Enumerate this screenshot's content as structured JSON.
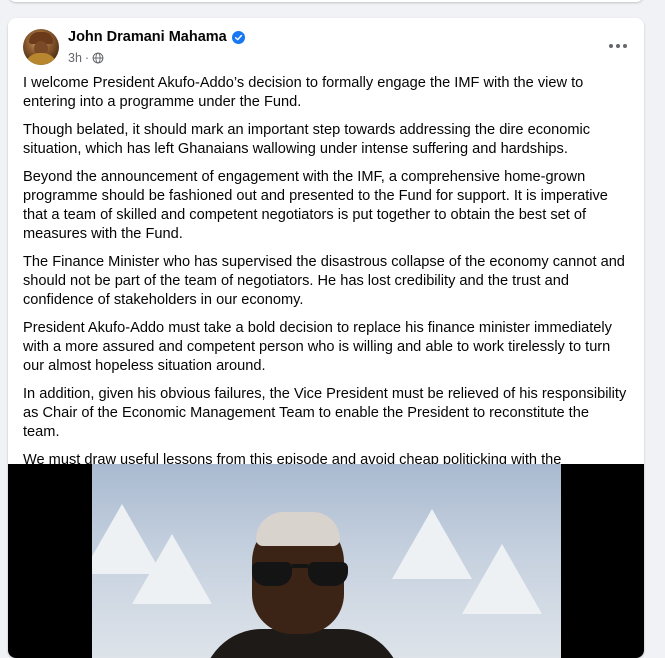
{
  "post": {
    "author": "John Dramani Mahama",
    "time": "3h",
    "separator": "·",
    "paragraphs": [
      "I welcome President Akufo-Addo’s decision to formally engage the IMF with the view to entering into a programme under the Fund.",
      "Though belated, it should mark an important step towards addressing the dire economic situation, which has left Ghanaians wallowing under intense suffering and hardships.",
      "Beyond the announcement of engagement with the IMF, a comprehensive home-grown programme should be fashioned out and presented to the Fund for support. It is imperative that a team of skilled and competent negotiators is put together to obtain the best set of measures with the Fund.",
      "The Finance Minister who has supervised the disastrous collapse of the economy cannot and should not be part of the team of negotiators. He has lost credibility and the trust and confidence of stakeholders in our economy.",
      "President Akufo-Addo must take a bold decision to replace his finance minister immediately with a more assured and competent person who is willing and able to work tirelessly to turn our almost hopeless situation around.",
      "In addition, given his obvious failures, the Vice President must be relieved of his responsibility as Chair of the Economic Management Team to enable the President to reconstitute the team.",
      "We must draw useful lessons from this episode and avoid cheap politicking with the economy; that can only yield the disastrous outcomes that have brought us here."
    ]
  },
  "icons": {
    "verified": "verified-badge-icon",
    "privacy": "globe-icon",
    "more": "more-options-icon"
  },
  "colors": {
    "verified_blue": "#1877f2",
    "text": "#050505",
    "secondary_text": "#65676b",
    "background": "#f0f2f5"
  }
}
